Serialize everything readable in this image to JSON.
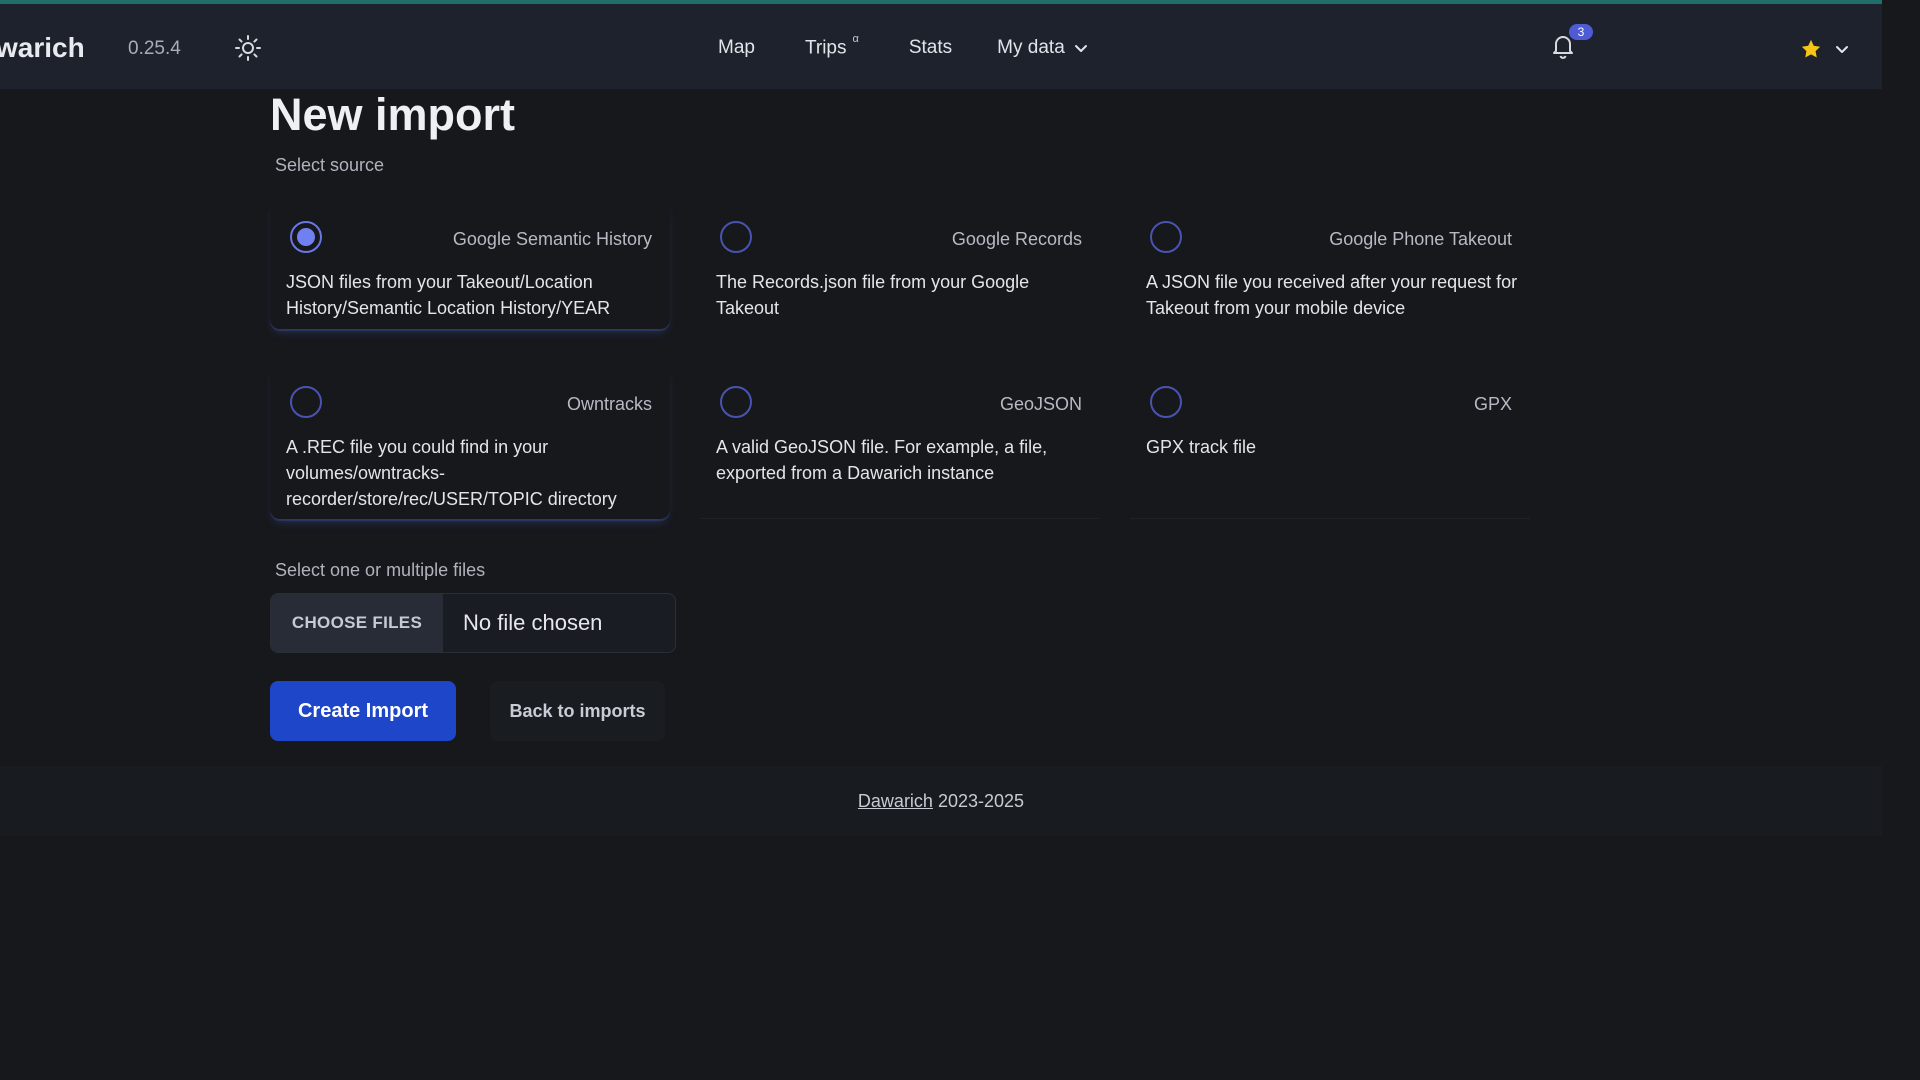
{
  "header": {
    "brand": "warich",
    "version": "0.25.4",
    "nav": {
      "map": "Map",
      "trips": "Trips",
      "trips_sup": "α",
      "stats": "Stats",
      "my_data": "My data"
    },
    "notifications_count": "3",
    "icons": {
      "theme": "sun-icon",
      "notifications": "bell-icon",
      "user": "star-icon"
    }
  },
  "page": {
    "title": "New import",
    "select_source_label": "Select source",
    "sources": [
      {
        "title": "Google Semantic History",
        "description": "JSON files from your Takeout/Location History/Semantic Location History/YEAR",
        "selected": true
      },
      {
        "title": "Google Records",
        "description": "The Records.json file from your Google Takeout",
        "selected": false
      },
      {
        "title": "Google Phone Takeout",
        "description": "A JSON file you received after your request for Takeout from your mobile device",
        "selected": false
      },
      {
        "title": "Owntracks",
        "description": "A .REC file you could find in your volumes/owntracks-recorder/store/rec/USER/TOPIC directory",
        "selected": false
      },
      {
        "title": "GeoJSON",
        "description": "A valid GeoJSON file. For example, a file, exported from a Dawarich instance",
        "selected": false
      },
      {
        "title": "GPX",
        "description": "GPX track file",
        "selected": false
      }
    ],
    "files_label": "Select one or multiple files",
    "choose_files": "CHOOSE FILES",
    "no_file": "No file chosen",
    "create_button": "Create Import",
    "back_button": "Back to imports"
  },
  "footer": {
    "link": "Dawarich",
    "years": "2023-2025"
  },
  "colors": {
    "accent": "#1d46c8",
    "radio": "#4a53b0",
    "navbar": "#1d222c",
    "background": "#16181c"
  }
}
